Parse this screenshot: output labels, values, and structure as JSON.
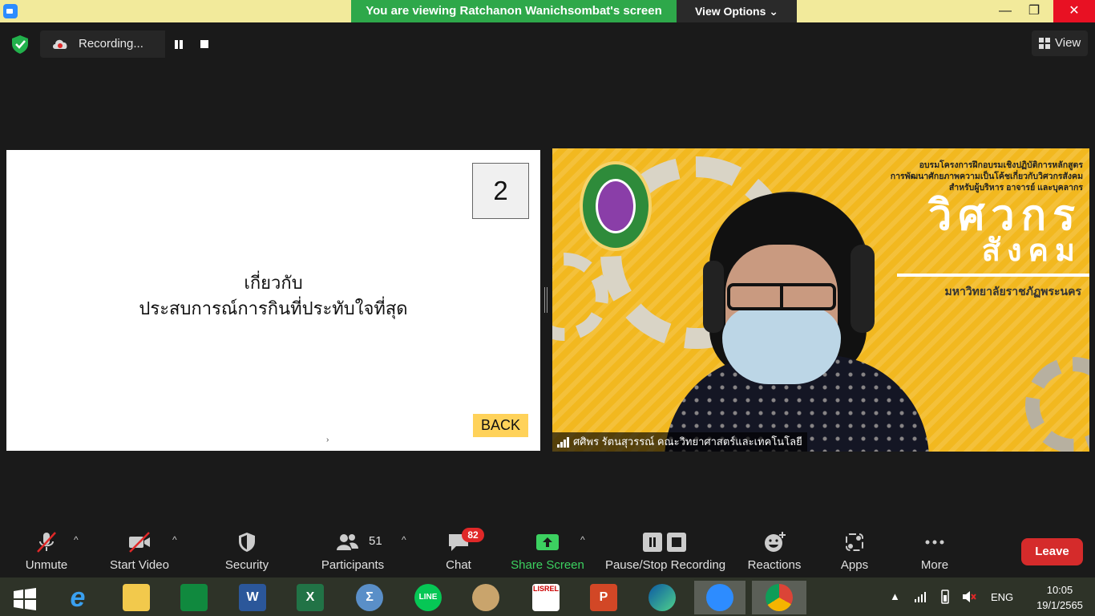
{
  "window": {
    "viewing_banner": "You are viewing Ratchanon Wanichsombat's screen",
    "view_options": "View Options ⌄",
    "minimize": "—",
    "maximize": "❐",
    "close": "✕"
  },
  "recording": {
    "label": "Recording..."
  },
  "view_button": {
    "label": "View"
  },
  "slide": {
    "page_number": "2",
    "title_line1": "เกี่ยวกับ",
    "title_line2": "ประสบการณ์การกินที่ประทับใจที่สุด",
    "back_button": "BACK",
    "cursor": "›"
  },
  "video": {
    "header_line1": "อบรมโครงการฝึกอบรมเชิงปฏิบัติการหลักสูตร",
    "header_line2": "การพัฒนาศักยภาพความเป็นโค้ชเกี่ยวกับวิศวกรสังคม",
    "header_line3": "สำหรับผู้บริหาร อาจารย์ และบุคลากร",
    "brand_line1": "วิศวกร",
    "brand_line2": "สังคม",
    "university": "มหาวิทยาลัยราชภัฏพระนคร",
    "participant_name": "ศศิพร รัตนสุวรรณ์ คณะวิทยาศาสตร์และเทคโนโลยี"
  },
  "toolbar": {
    "unmute": "Unmute",
    "start_video": "Start Video",
    "security": "Security",
    "participants": "Participants",
    "participants_count": "51",
    "chat": "Chat",
    "chat_badge": "82",
    "share_screen": "Share Screen",
    "pause_stop_recording": "Pause/Stop Recording",
    "reactions": "Reactions",
    "apps": "Apps",
    "more": "More",
    "leave": "Leave",
    "caret": "^"
  },
  "taskbar": {
    "language": "ENG",
    "time": "10:05",
    "date": "19/1/2565",
    "apps": [
      {
        "name": "start",
        "label": ""
      },
      {
        "name": "internet-explorer",
        "label": "e"
      },
      {
        "name": "file-explorer",
        "label": ""
      },
      {
        "name": "store",
        "label": ""
      },
      {
        "name": "word",
        "label": "W"
      },
      {
        "name": "excel",
        "label": "X"
      },
      {
        "name": "math-input",
        "label": "Σ"
      },
      {
        "name": "line",
        "label": "LINE"
      },
      {
        "name": "paint",
        "label": ""
      },
      {
        "name": "lisrel",
        "label": "LISREL"
      },
      {
        "name": "powerpoint",
        "label": "P"
      },
      {
        "name": "edge",
        "label": ""
      },
      {
        "name": "zoom",
        "label": ""
      },
      {
        "name": "chrome",
        "label": ""
      }
    ]
  },
  "colors": {
    "banner_green": "#2ea84a",
    "leave_red": "#d52b2b",
    "share_green": "#3cd160",
    "chat_badge_red": "#e02828",
    "video_yellow": "#f2b81f"
  }
}
